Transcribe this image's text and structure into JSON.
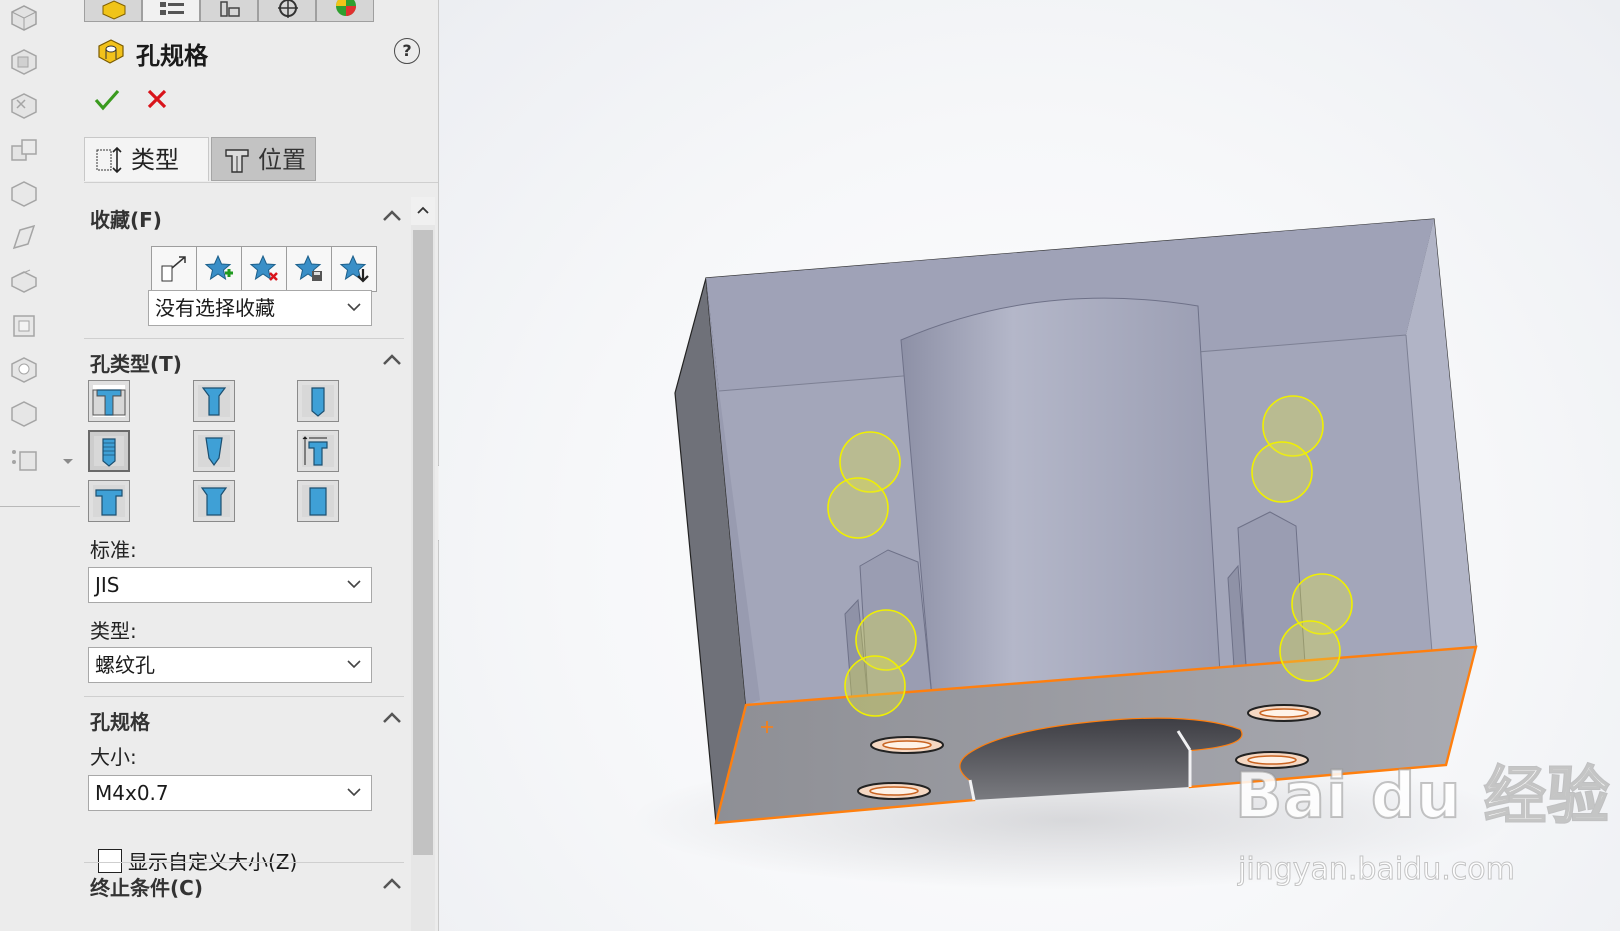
{
  "panel": {
    "title": "孔规格",
    "help_label": "?",
    "tabs": {
      "type": "类型",
      "position": "位置"
    },
    "sections": {
      "favorites": {
        "title": "收藏(F)",
        "dropdown_value": "没有选择收藏"
      },
      "hole_type": {
        "title": "孔类型(T)",
        "standard_label": "标准:",
        "standard_value": "JIS",
        "type_label": "类型:",
        "type_value": "螺纹孔"
      },
      "hole_spec": {
        "title": "孔规格",
        "size_label": "大小:",
        "size_value": "M4x0.7",
        "custom_size_label": "显示自定义大小(Z)",
        "custom_size_checked": false
      },
      "end_condition": {
        "title": "终止条件(C)"
      }
    }
  },
  "watermark": {
    "logo": "Bai du 经验",
    "url": "jingyan.baidu.com"
  },
  "colors": {
    "ok": "#3a9a1e",
    "cancel": "#d9141b",
    "model_face": "#a4a7bc",
    "model_edge_highlight": "#ff7f0e",
    "hole_preview": "#f0f000"
  }
}
